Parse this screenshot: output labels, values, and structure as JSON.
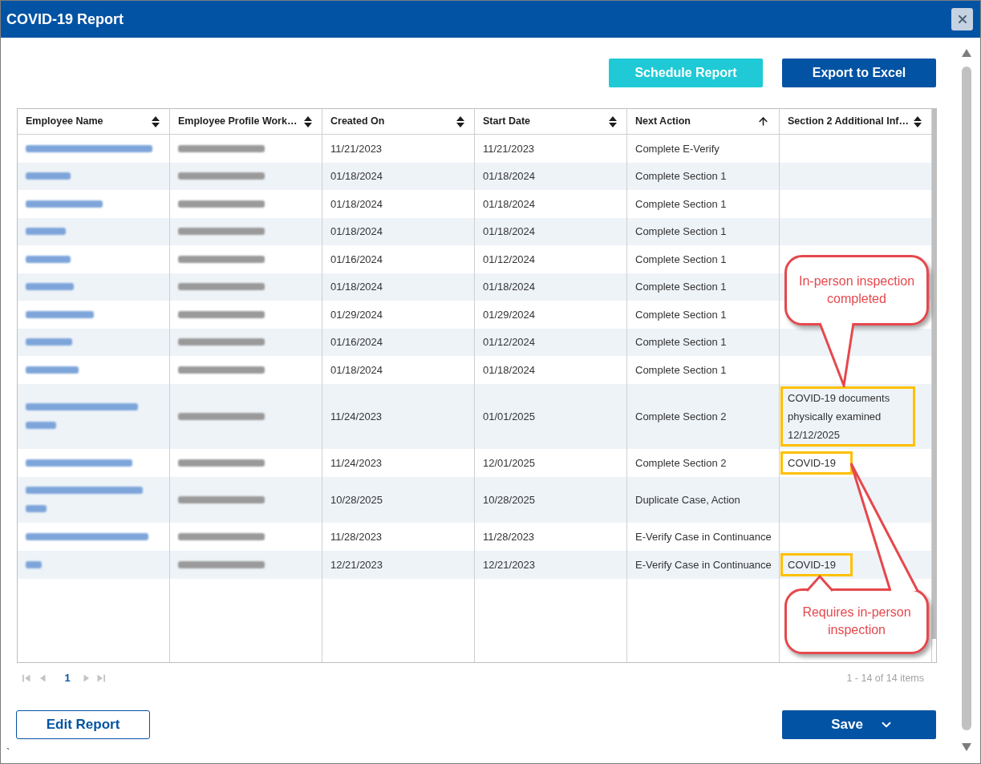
{
  "window": {
    "title": "COVID-19 Report"
  },
  "toolbar": {
    "buttons": [
      {
        "label": "Schedule Report",
        "kind": "accent"
      },
      {
        "label": "Export to Excel",
        "kind": "primary"
      }
    ]
  },
  "table": {
    "columns": [
      {
        "label": "Employee Name",
        "sorted": false
      },
      {
        "label": "Employee Profile Work…",
        "sorted": false
      },
      {
        "label": "Created On",
        "sorted": false
      },
      {
        "label": "Start Date",
        "sorted": false
      },
      {
        "label": "Next Action",
        "sorted": true
      },
      {
        "label": "Section 2 Additional Inf…",
        "sorted": false
      }
    ],
    "rows": [
      {
        "cells": [
          {
            "kind": "blurred",
            "link": true
          },
          {
            "kind": "blurred",
            "link": false
          },
          "11/21/2023",
          "11/21/2023",
          "Complete E-Verify"
        ]
      },
      {
        "cells": [
          {
            "kind": "blurred",
            "link": true
          },
          {
            "kind": "blurred",
            "link": false
          },
          "01/18/2024",
          "01/18/2024",
          "Complete Section 1"
        ]
      },
      {
        "cells": [
          {
            "kind": "blurred",
            "link": true
          },
          {
            "kind": "blurred",
            "link": false
          },
          "01/18/2024",
          "01/18/2024",
          "Complete Section 1"
        ]
      },
      {
        "cells": [
          {
            "kind": "blurred",
            "link": true
          },
          {
            "kind": "blurred",
            "link": false
          },
          "01/18/2024",
          "01/18/2024",
          "Complete Section 1"
        ]
      },
      {
        "cells": [
          {
            "kind": "blurred",
            "link": true
          },
          {
            "kind": "blurred",
            "link": false
          },
          "01/16/2024",
          "01/12/2024",
          "Complete Section 1"
        ]
      },
      {
        "cells": [
          {
            "kind": "blurred",
            "link": true
          },
          {
            "kind": "blurred",
            "link": false
          },
          "01/18/2024",
          "01/18/2024",
          "Complete Section 1"
        ]
      },
      {
        "cells": [
          {
            "kind": "blurred",
            "link": true
          },
          {
            "kind": "blurred",
            "link": false
          },
          "01/29/2024",
          "01/29/2024",
          "Complete Section 1"
        ]
      },
      {
        "cells": [
          {
            "kind": "blurred",
            "link": true
          },
          {
            "kind": "blurred",
            "link": false
          },
          "01/16/2024",
          "01/12/2024",
          "Complete Section 1"
        ]
      },
      {
        "cells": [
          {
            "kind": "blurred",
            "link": true
          },
          {
            "kind": "blurred",
            "link": false
          },
          "01/18/2024",
          "01/18/2024",
          "Complete Section 1"
        ]
      },
      {
        "cells": [
          {
            "kind": "blurred",
            "link": true
          },
          {
            "kind": "blurred",
            "link": false
          },
          "11/24/2023",
          "01/01/2025",
          "Complete Section 2",
          {
            "kind": "note",
            "text": "COVID-19 documents physically examined 12/12/2025",
            "highlighted": true
          }
        ]
      },
      {
        "cells": [
          {
            "kind": "blurred",
            "link": true
          },
          {
            "kind": "blurred",
            "link": false
          },
          "11/24/2023",
          "12/01/2025",
          "Complete Section 2",
          {
            "kind": "note",
            "text": "COVID-19",
            "highlighted": true
          }
        ]
      },
      {
        "cells": [
          {
            "kind": "blurred",
            "link": true
          },
          {
            "kind": "blurred",
            "link": false
          },
          "10/28/2025",
          "10/28/2025",
          "Duplicate Case, Action"
        ]
      },
      {
        "cells": [
          {
            "kind": "blurred",
            "link": true
          },
          {
            "kind": "blurred",
            "link": false
          },
          "11/28/2023",
          "11/28/2023",
          "E-Verify Case in Continuance"
        ]
      },
      {
        "cells": [
          {
            "kind": "blurred",
            "link": true
          },
          {
            "kind": "blurred",
            "link": false
          },
          "12/21/2023",
          "12/21/2023",
          "E-Verify Case in Continuance",
          {
            "kind": "note",
            "text": "COVID-19",
            "highlighted": true
          }
        ]
      }
    ]
  },
  "annotations": [
    {
      "text": "In-person inspection completed"
    },
    {
      "text": "Requires in-person inspection"
    }
  ],
  "pager": {
    "controls": [
      {
        "kind": "first",
        "disabled": true
      },
      {
        "kind": "previous",
        "disabled": true
      },
      {
        "kind": "page",
        "label": "1",
        "selected": true
      },
      {
        "kind": "next",
        "disabled": true
      },
      {
        "kind": "last",
        "disabled": true
      }
    ],
    "summary": "1 - 14 of 14 items"
  },
  "footer": {
    "buttons": [
      {
        "label": "Edit Report",
        "kind": "outline"
      },
      {
        "label": "Save",
        "kind": "dropdown"
      }
    ]
  },
  "stray_mark": "`"
}
